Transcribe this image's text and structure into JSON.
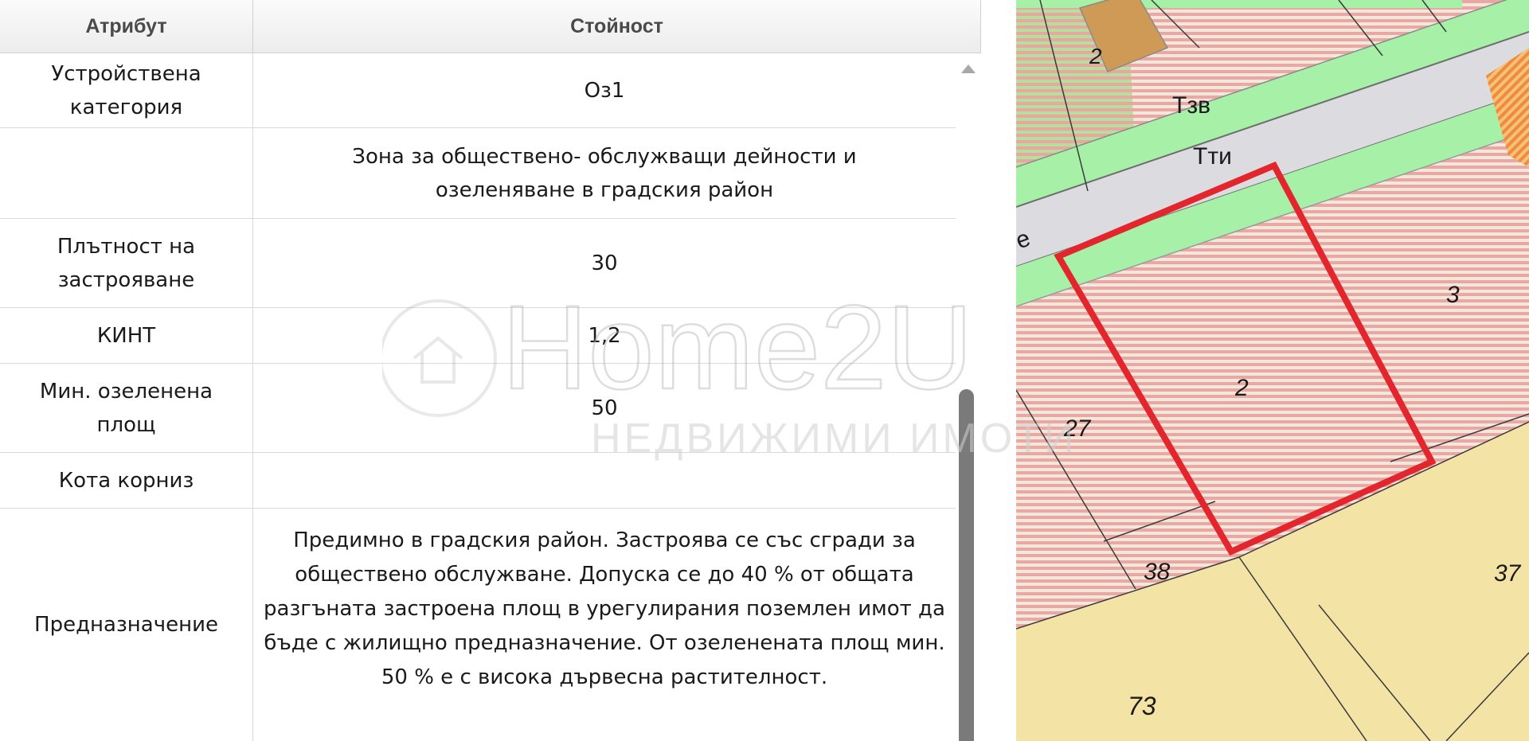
{
  "table": {
    "headers": {
      "attribute": "Атрибут",
      "value": "Стойност"
    },
    "rows": [
      {
        "attribute": "Устройствена категория",
        "value": "Оз1"
      },
      {
        "attribute": "",
        "value": "Зона за обществено- обслужващи дейности и озеленяване в градския район"
      },
      {
        "attribute": "Плътност на застрояване",
        "value": "30"
      },
      {
        "attribute": "КИНТ",
        "value": "1,2"
      },
      {
        "attribute": "Мин. озеленена площ",
        "value": "50"
      },
      {
        "attribute": "Кота корниз",
        "value": ""
      },
      {
        "attribute": "Предназначение",
        "value": "Предимно в градския район. Застроява се със сгради за обществено обслужване. Допуска се до 40 % от общата разгъната застроена площ в урегулирания поземлен имот да бъде с жилищно предназначение. От озеленената площ мин. 50 % е с висока дървесна растителност."
      }
    ]
  },
  "map": {
    "labels": {
      "zone_tzv": "Тзв",
      "zone_tti": "Тти",
      "street_fragment": "е",
      "plot_2_top": "2",
      "plot_3": "3",
      "plot_2": "2",
      "plot_27": "27",
      "plot_38": "38",
      "plot_37": "37",
      "plot_73": "73"
    },
    "colors": {
      "hatch_pink": "#e9a9a2",
      "hatch_green": "#b8dd9f",
      "green_strip": "#a6f0a8",
      "road": "#dcdce0",
      "yellow_zone": "#f3e3a4",
      "highlight": "#e3262d",
      "orange_plot": "#cf9a55"
    }
  },
  "watermark": {
    "brand": "Home2U",
    "tagline": "НЕДВИЖИМИ ИМОТИ"
  }
}
